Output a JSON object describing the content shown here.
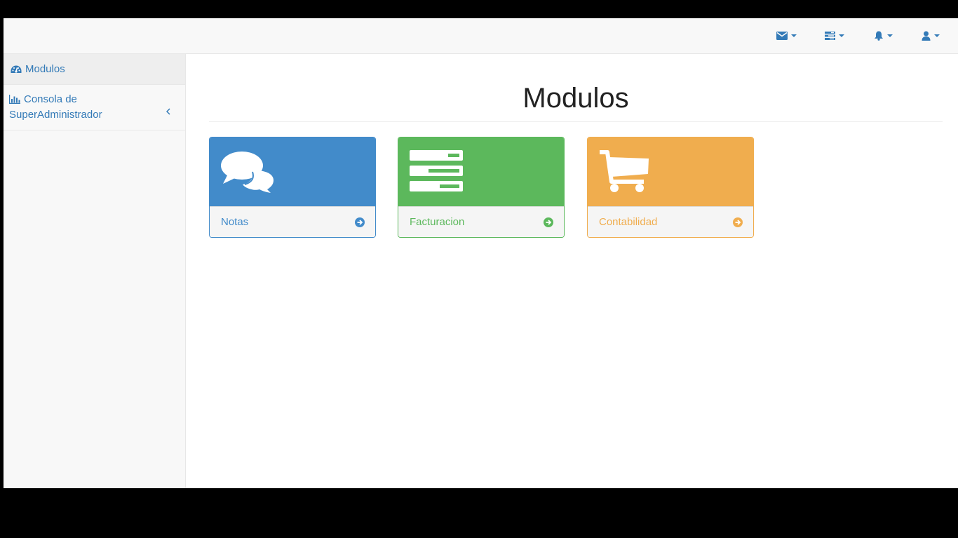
{
  "colors": {
    "primary": "#337ab7",
    "blue": "#428bca",
    "green": "#5cb85c",
    "yellow": "#f0ad4e"
  },
  "navbar": {
    "dropdowns": [
      {
        "icon": "envelope-icon"
      },
      {
        "icon": "tasks-icon"
      },
      {
        "icon": "bell-icon"
      },
      {
        "icon": "user-icon"
      }
    ]
  },
  "sidebar": {
    "items": [
      {
        "label": "Modulos",
        "icon": "dashboard-icon",
        "active": true
      },
      {
        "label": "Consola de SuperAdministrador",
        "icon": "bar-chart-icon",
        "expand_icon": "chevron-left-icon"
      }
    ]
  },
  "main": {
    "title": "Modulos",
    "panels": [
      {
        "label": "Notas",
        "icon": "comments-icon",
        "link_icon": "arrow-circle-right-icon",
        "color": "#428bca"
      },
      {
        "label": "Facturacion",
        "icon": "server-icon",
        "link_icon": "arrow-circle-right-icon",
        "color": "#5cb85c"
      },
      {
        "label": "Contabilidad",
        "icon": "shopping-cart-icon",
        "link_icon": "arrow-circle-right-icon",
        "color": "#f0ad4e"
      }
    ]
  }
}
